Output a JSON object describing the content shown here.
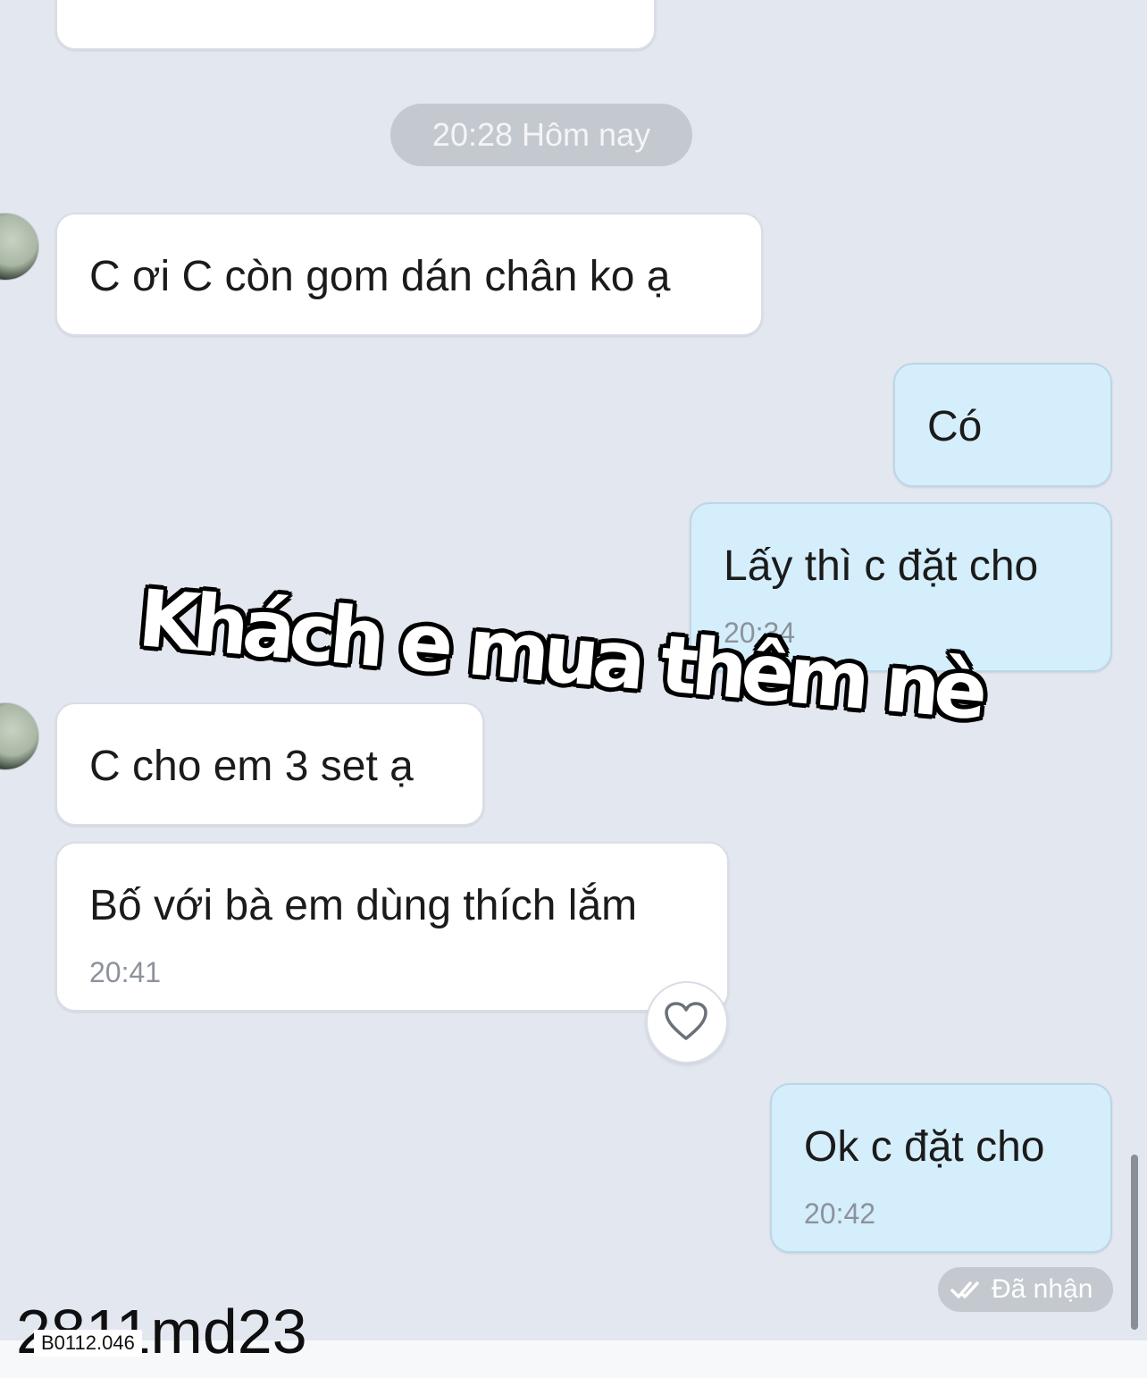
{
  "header": {
    "timestamp_pill": "20:28 Hôm nay"
  },
  "messages": [
    {
      "id": "m1",
      "direction": "incoming",
      "text": "C ơi C còn gom dán chân ko ạ",
      "time": ""
    },
    {
      "id": "m2",
      "direction": "outgoing",
      "text": "Có",
      "time": ""
    },
    {
      "id": "m3",
      "direction": "outgoing",
      "text": "Lấy thì c đặt cho",
      "time": "20:34"
    },
    {
      "id": "m4",
      "direction": "incoming",
      "text": "C cho em 3 set ạ",
      "time": ""
    },
    {
      "id": "m5",
      "direction": "incoming",
      "text": "Bố với bà em dùng thích lắm",
      "time": "20:41"
    },
    {
      "id": "m6",
      "direction": "outgoing",
      "text": "Ok c đặt cho",
      "time": "20:42"
    }
  ],
  "status": {
    "label": "Đã nhận",
    "icon": "double-check-icon"
  },
  "reaction": {
    "icon": "heart-outline-icon"
  },
  "overlay_caption": "Khách e mua thêm nè",
  "watermark": {
    "code": "B0112.046",
    "text": "2811md23"
  },
  "colors": {
    "background": "#e3e7f0",
    "incoming_bubble": "#ffffff",
    "outgoing_bubble": "#d5eefb",
    "pill": "#c4c8cf"
  }
}
